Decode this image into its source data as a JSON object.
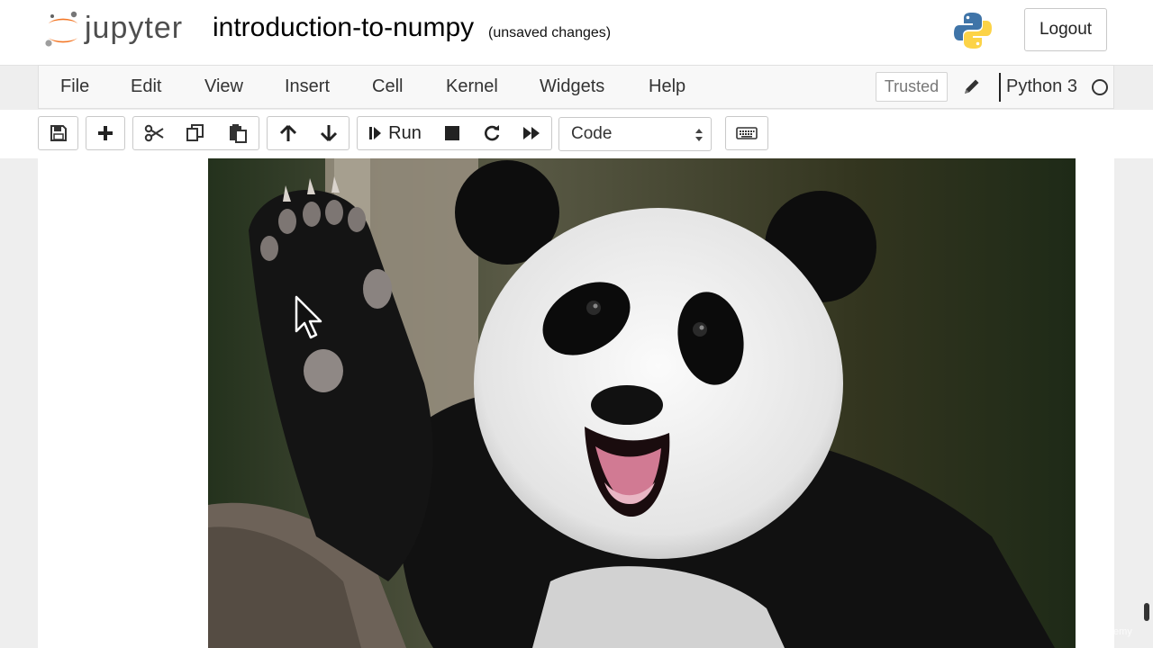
{
  "header": {
    "logo_text": "jupyter",
    "notebook_name": "introduction-to-numpy",
    "save_status": "(unsaved changes)",
    "logout_label": "Logout"
  },
  "menubar": {
    "items": [
      {
        "label": "File"
      },
      {
        "label": "Edit"
      },
      {
        "label": "View"
      },
      {
        "label": "Insert"
      },
      {
        "label": "Cell"
      },
      {
        "label": "Kernel"
      },
      {
        "label": "Widgets"
      },
      {
        "label": "Help"
      }
    ],
    "trusted_label": "Trusted",
    "kernel_name": "Python 3"
  },
  "toolbar": {
    "buttons": [
      {
        "icon": "save-icon"
      },
      {
        "icon": "plus-icon"
      },
      {
        "icon": "scissors-icon"
      },
      {
        "icon": "copy-icon"
      },
      {
        "icon": "paste-icon"
      },
      {
        "icon": "arrow-up-icon"
      },
      {
        "icon": "arrow-down-icon"
      },
      {
        "icon": "step-forward-icon"
      },
      {
        "icon": "stop-icon"
      },
      {
        "icon": "restart-icon"
      },
      {
        "icon": "fast-forward-icon"
      },
      {
        "icon": "keyboard-icon"
      }
    ],
    "run_label": "Run",
    "cell_type": "Code"
  },
  "output": {
    "image_subject": "panda"
  },
  "watermark": "Udemy",
  "colors": {
    "jupyter_orange": "#f37726",
    "header_bg": "#ffffff",
    "page_bg": "#eeeeee",
    "menubar_bg": "#f8f8f8"
  }
}
